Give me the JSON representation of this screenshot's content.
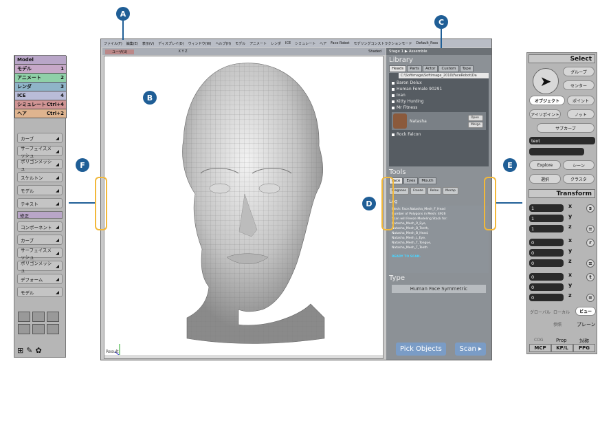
{
  "callouts": {
    "a": "A",
    "b": "B",
    "c": "C",
    "d": "D",
    "e": "E",
    "f": "F"
  },
  "main": {
    "menu": [
      "ファイル(F)",
      "編集(E)",
      "表示(V)",
      "ディスプレイ(D)",
      "ウィンドウ(W)",
      "ヘルプ(H)",
      "モデル",
      "アニメート",
      "レンダ",
      "ICE",
      "シミュレート",
      "ヘア",
      "Face Robot",
      "モデリングコンストラクションモード",
      "Default_Pass"
    ],
    "viewport_toolbar": {
      "camera": "ユーザ(U)",
      "xyz": "X Y Z",
      "shading": "Shaded"
    },
    "result_label": "Result"
  },
  "faceroot": {
    "stage": "Stage 1 ▶ Assemble",
    "library_title": "Library",
    "tabs": [
      "Heads",
      "Parts",
      "Actor",
      "Custom",
      "Type"
    ],
    "path": "C:\\Softimage\\Softimage_2010\\FaceRobot\\Da",
    "items": [
      "Baron Delux",
      "Human Female 90291",
      "Ivan",
      "Kitty Hunting",
      "Mr Fitness"
    ],
    "selected": "Natasha",
    "open": "Open",
    "merge": "Merge",
    "last_item": "Rock Falcon",
    "tools_title": "Tools",
    "tools_tabs": [
      "Face",
      "Eyes",
      "Mouth"
    ],
    "tool_buttons": [
      "Diagnose",
      "Freeze",
      "Relax",
      "Mocap"
    ],
    "log_title": "Log",
    "log_lines": [
      "Mesh: Face.Natasha_Mesh_F_Head",
      "Number of Polygons in Mesh: 4926",
      "Scan will Freeze Modeling Stack for:",
      "Natasha_Mesh_R_Eye,",
      "Natasha_Mesh_B_Teeth,",
      "Natasha_Mesh_B_Head,",
      "Natasha_Mesh_L_Eye,",
      "Natasha_Mesh_T_Tongue,",
      "Natasha_Mesh_T_Teeth",
      "READY TO SCAN."
    ],
    "type_title": "Type",
    "type_value": "Human Face Symmetric",
    "pick": "Pick Objects",
    "scan": "Scan ▸"
  },
  "left": {
    "menu": [
      {
        "label": "Model",
        "key": "",
        "color": "#b9a6c8"
      },
      {
        "label": "モデル",
        "key": "1",
        "color": "#c7a8c8"
      },
      {
        "label": "アニメート",
        "key": "2",
        "color": "#8fd0a8"
      },
      {
        "label": "レンダ",
        "key": "3",
        "color": "#8fb4c8"
      },
      {
        "label": "ICE",
        "key": "4",
        "color": "#b9bcd8"
      },
      {
        "label": "シミュレート",
        "key": "Ctrl+4",
        "color": "#d09494"
      },
      {
        "label": "ヘア",
        "key": "Ctrl+2",
        "color": "#dfb48f"
      }
    ],
    "buttons_top": [
      "カーブ",
      "サーフェイスメッシュ",
      "ポリゴンメッシュ",
      "スケルトン",
      "モデル",
      "テキスト"
    ],
    "section": "修正",
    "buttons_bottom": [
      "コンポーネント",
      "カーブ",
      "サーフェイスメッシュ",
      "ポリゴンメッシュ",
      "デフォーム",
      "モデル"
    ]
  },
  "right": {
    "select": "Select",
    "group": "グループ",
    "center": "センター",
    "object": "オブジェクト",
    "point": "ポイント",
    "polygon_island": "アイソポイント",
    "knot": "ノット",
    "subcurve": "サブカーブ",
    "text": "text",
    "explore": "Explore",
    "scene": "シーン",
    "select2": "選択",
    "cluster": "クラスタ",
    "transform": "Transform",
    "scale": [
      "1",
      "1",
      "1"
    ],
    "rotate": [
      "0",
      "0",
      "0"
    ],
    "translate": [
      "0",
      "0",
      "0"
    ],
    "axes": [
      "x",
      "y",
      "z"
    ],
    "global": "グローバル",
    "local": "ローカル",
    "view": "ビュー",
    "ref": "参照",
    "plane": "プレーン",
    "cog": "COG",
    "prop": "Prop",
    "sym": "対称",
    "tabs": [
      "MCP",
      "KP/L",
      "PPG"
    ]
  }
}
